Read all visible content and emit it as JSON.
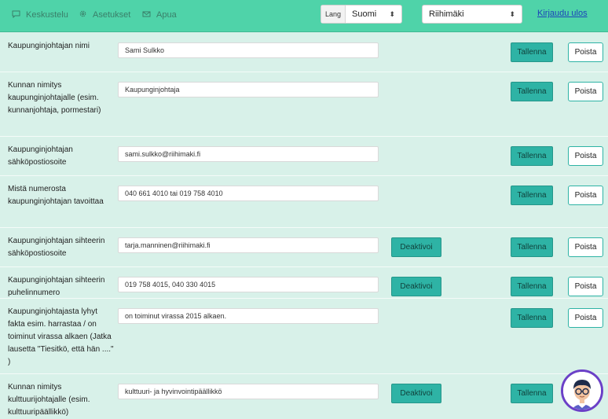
{
  "nav": {
    "items": [
      {
        "label": "Keskustelu",
        "icon": "chat-icon"
      },
      {
        "label": "Asetukset",
        "icon": "gear-icon"
      },
      {
        "label": "Apua",
        "icon": "help-icon"
      }
    ],
    "lang_label": "Lang",
    "lang_value": "Suomi",
    "city_value": "Riihimäki",
    "logout": "Kirjaudu ulos"
  },
  "buttons": {
    "save": "Tallenna",
    "delete": "Poista",
    "deactivate": "Deaktivoi"
  },
  "rows": [
    {
      "label": "Kaupunginjohtajan nimi",
      "value": "Sami Sulkko"
    },
    {
      "label": "Kunnan nimitys kaupunginjohtajalle (esim. kunnanjohtaja, pormestari)",
      "value": "Kaupunginjohtaja"
    },
    {
      "label": "Kaupunginjohtajan sähköpostiosoite",
      "value": "sami.sulkko@riihimaki.fi"
    },
    {
      "label": "Mistä numerosta kaupunginjohtajan tavoittaa",
      "value": "040 661 4010 tai 019 758 4010"
    },
    {
      "label": "Kaupunginjohtajan sihteerin sähköpostiosoite",
      "value": "tarja.manninen@riihimaki.fi"
    },
    {
      "label": "Kaupunginjohtajan sihteerin puhelinnumero",
      "value": "019 758 4015, 040 330 4015"
    },
    {
      "label": "Kaupunginjohtajasta lyhyt fakta esim. harrastaa / on toiminut virassa alkaen (Jatka lausetta \"Tiesitkö, että hän ....\" )",
      "value": "on toiminut virassa 2015 alkaen."
    },
    {
      "label": "Kunnan nimitys kulttuurijohtajalle (esim. kulttuuripäällikkö)",
      "value": "kulttuuri- ja hyvinvointipäällikkö"
    }
  ],
  "colors": {
    "topbar": "#4fd3a9",
    "background": "#d8f1e9",
    "button": "#2eb3a5",
    "link": "#1c44b9",
    "avatar_ring": "#6b40c7"
  }
}
